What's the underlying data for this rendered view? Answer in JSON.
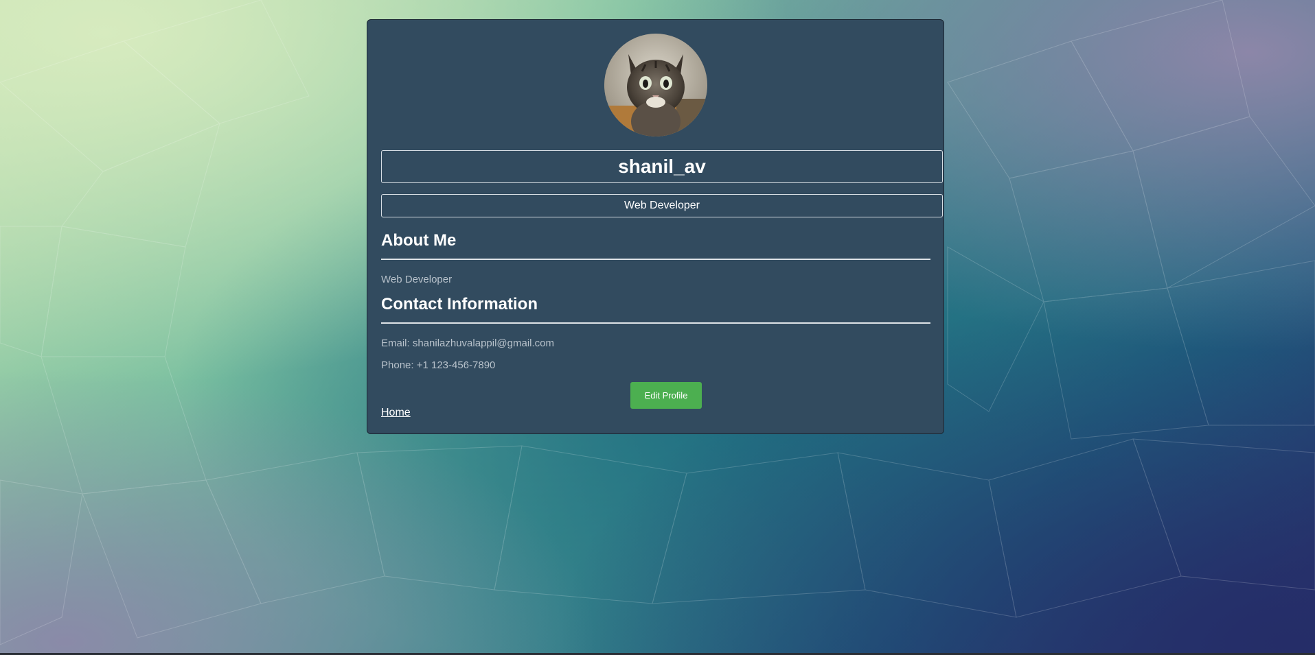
{
  "profile": {
    "avatar_icon": "cat-photo",
    "username": "shanil_av",
    "role": "Web Developer"
  },
  "about": {
    "heading": "About Me",
    "text": "Web Developer"
  },
  "contact": {
    "heading": "Contact Information",
    "email": "Email: shanilazhuvalappil@gmail.com",
    "phone": "Phone: +1 123-456-7890"
  },
  "actions": {
    "edit_label": "Edit Profile",
    "home_label": "Home"
  },
  "colors": {
    "card_bg": "#324b5f",
    "edit_button": "#4caf50",
    "muted_text": "#b8c2cb"
  }
}
